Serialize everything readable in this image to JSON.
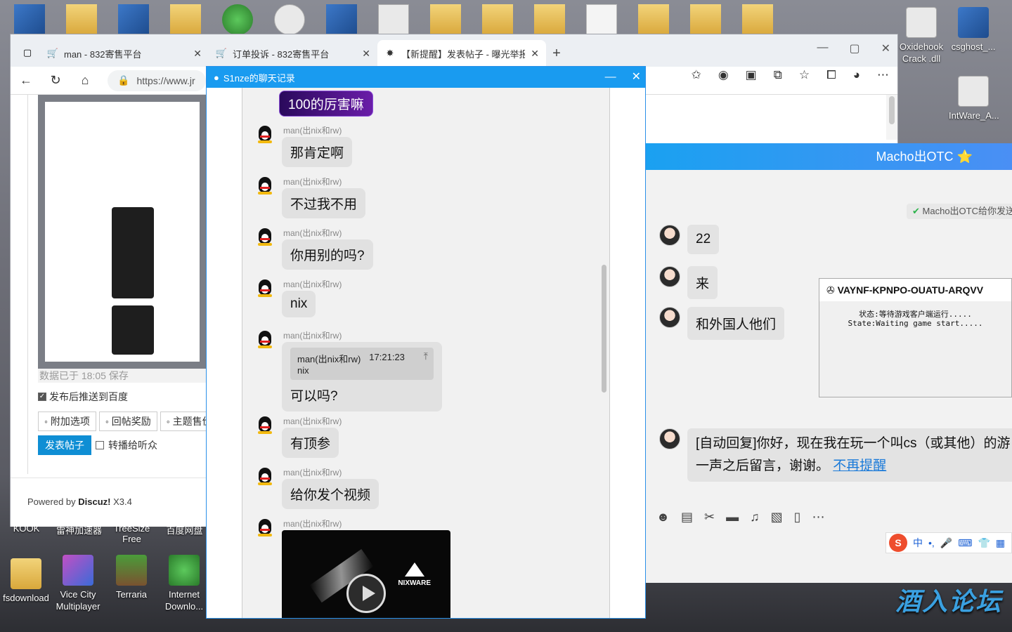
{
  "desktop": {
    "icons_top_right": [
      {
        "label": "Oxidehook Crack .dll",
        "icon": "gear-icon"
      },
      {
        "label": "csghost_...",
        "icon": "app-icon"
      },
      {
        "label": "IntWare_A...",
        "icon": "gear-icon"
      }
    ],
    "icons_bottom_left": [
      {
        "label": "fsdownload",
        "icon": "archive-icon"
      },
      {
        "label": "Vice City Multiplayer",
        "icon": "game-icon"
      },
      {
        "label": "Terraria",
        "icon": "tree-icon"
      },
      {
        "label": "Internet Downlo...",
        "icon": "globe-icon"
      }
    ],
    "partial_labels": [
      "KOOK",
      "雷神加速器",
      "TreeSize Free",
      "百度网盘"
    ],
    "watermark": "酒入论坛"
  },
  "browser": {
    "tabs": [
      {
        "title": "man - 832寄售平台",
        "icon": "cart-icon",
        "active": false
      },
      {
        "title": "订单投诉 - 832寄售平台",
        "icon": "cart-icon",
        "active": false
      },
      {
        "title": "【新提醒】发表帖子 - 曝光举报",
        "icon": "puzzle-icon",
        "active": true
      }
    ],
    "new_tab": "+",
    "url": "https://www.jr",
    "forum": {
      "save_status": "数据已于 18:05 保存",
      "push_baidu": "发布后推送到百度",
      "options": [
        "附加选项",
        "回帖奖励",
        "主题售价"
      ],
      "submit": "发表帖子",
      "broadcast": "转播给听众",
      "powered": "Powered by",
      "powered_brand": "Discuz!",
      "powered_ver": "X3.4"
    }
  },
  "chat_history": {
    "title": "S1nze的聊天记录",
    "sender": "man(出nix和rw)",
    "messages": [
      {
        "text": "100的厉害嘛",
        "style": "purple"
      },
      {
        "text": "那肯定啊"
      },
      {
        "text": "不过我不用"
      },
      {
        "text": "你用别的吗?"
      },
      {
        "text": "nix"
      },
      {
        "text": "可以吗?",
        "quote_sender": "man(出nix和rw)",
        "quote_time": "17:21:23",
        "quote_text": "nix"
      },
      {
        "text": "有顶参"
      },
      {
        "text": "给你发个视频"
      }
    ],
    "video_logo": "NIXWARE"
  },
  "qq_chat": {
    "title": "Macho出OTC",
    "title_badge": "⭐",
    "system_notice": "Macho出OTC给你发送",
    "messages": [
      "22",
      "来",
      "和外国人他们"
    ],
    "auto_reply": "[自动回复]你好，现在我在玩一个叫cs（或其他）的游",
    "auto_reply_line2": "一声之后留言，谢谢。",
    "auto_reply_link": "不再提醒",
    "ime_label": "中"
  },
  "key_popup": {
    "title": "VAYNF-KPNPO-OUATU-ARQVV",
    "line1": "状态:等待游戏客户端运行.....",
    "line2": "State:Waiting game start....."
  }
}
